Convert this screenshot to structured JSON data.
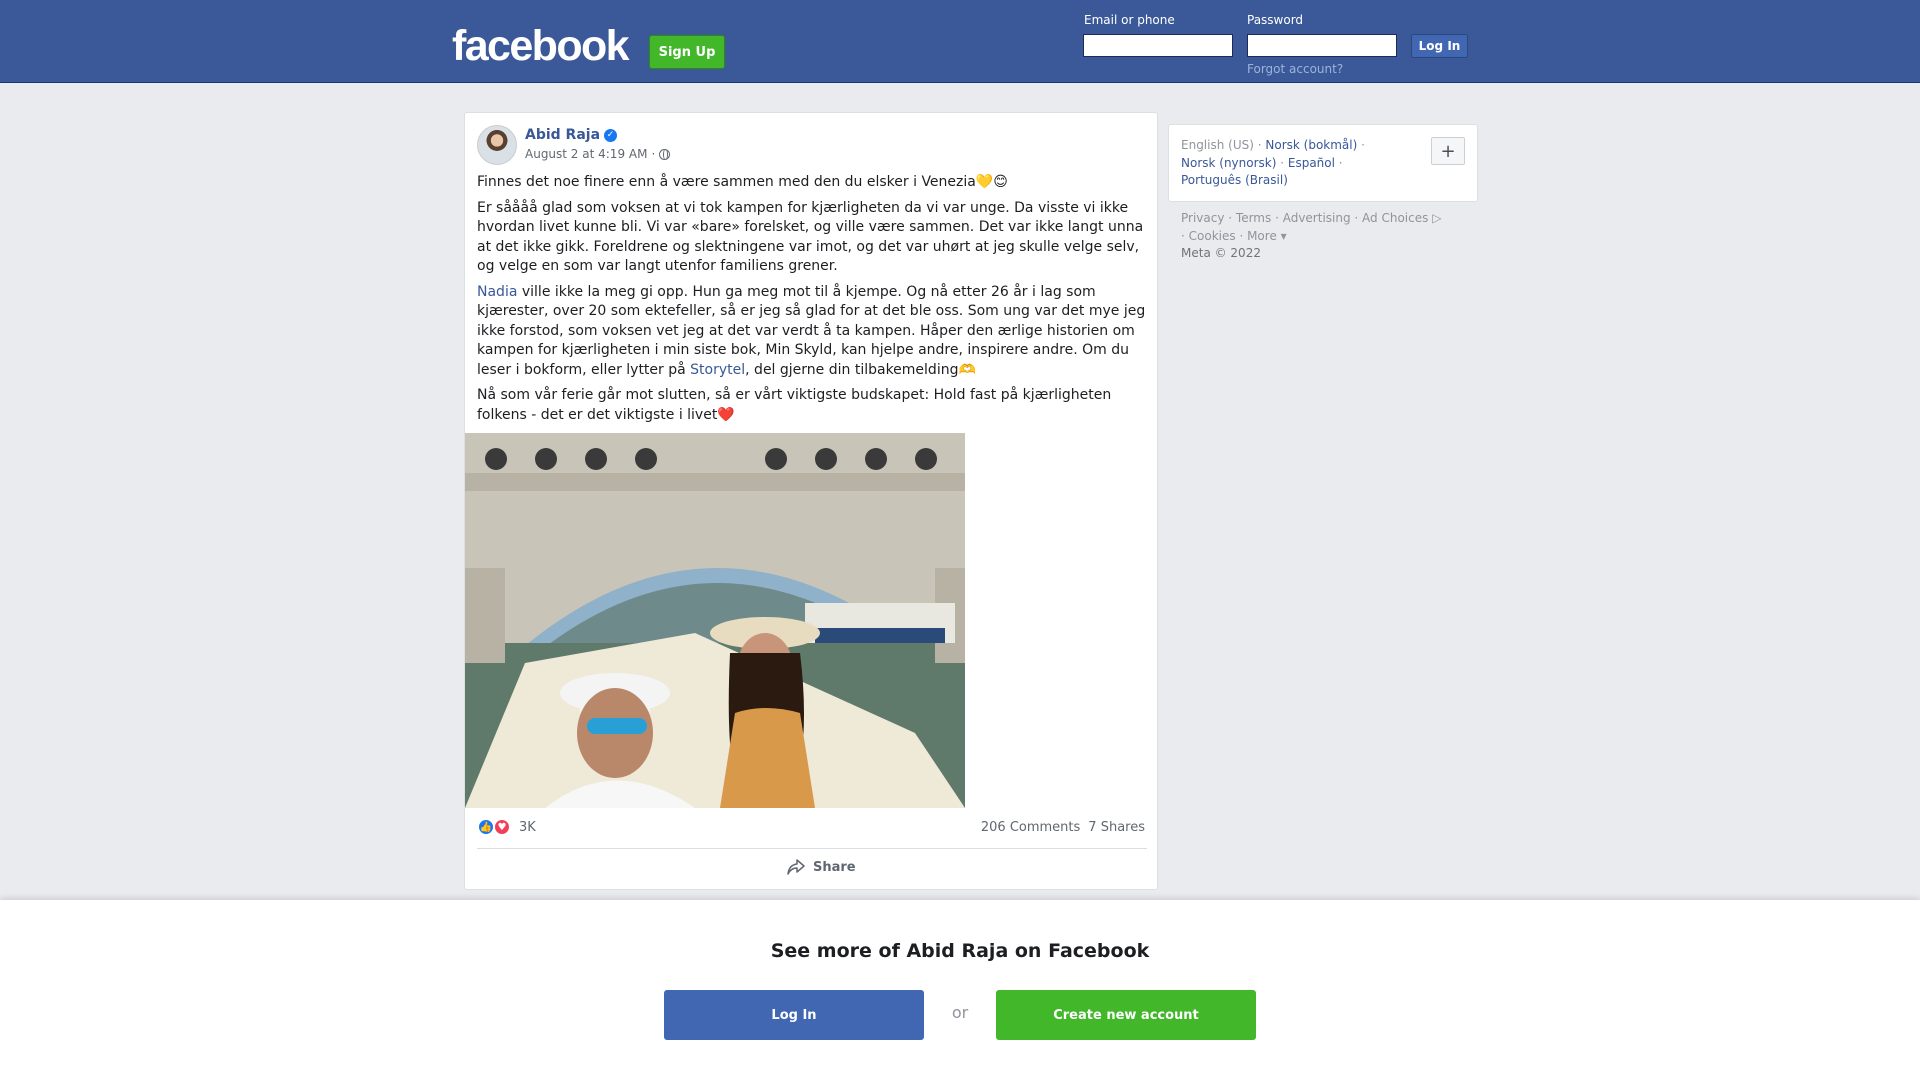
{
  "header": {
    "logo": "facebook",
    "signup_label": "Sign Up",
    "email_label": "Email or phone",
    "password_label": "Password",
    "login_label": "Log In",
    "forgot_label": "Forgot account?"
  },
  "post": {
    "author": "Abid Raja",
    "timestamp": "August 2 at 4:19 AM",
    "paragraphs": {
      "p1": "Finnes det noe finere enn å være sammen med den du elsker i Venezia💛😊",
      "p2": "Er såååå glad som voksen at vi tok kampen for kjærligheten da vi var unge. Da visste vi ikke hvordan livet kunne bli. Vi var «bare» forelsket, og ville være sammen. Det var ikke langt unna at det ikke gikk. Foreldrene og slektningene var imot, og det var uhørt at jeg skulle velge selv, og velge en som var langt utenfor familiens grener.",
      "p3_link": "Nadia",
      "p3_text": " ville ikke la meg gi opp. Hun ga meg mot til å kjempe. Og nå etter 26 år i lag som kjærester, over 20 som ektefeller, så er jeg så glad for at det ble oss. Som ung var det mye jeg ikke forstod, som voksen vet jeg at det var verdt å ta kampen. Håper den ærlige historien om kampen for kjærligheten i min siste bok, Min Skyld, kan hjelpe andre, inspirere andre. Om du leser i bokform, eller lytter på ",
      "p3_link2": "Storytel",
      "p3_end": ", del gjerne din tilbakemelding🫶",
      "p4": "Nå som vår ferie går mot slutten, så er vårt viktigste budskapet: Hold fast på kjærligheten folkens - det er det viktigste i livet❤️"
    },
    "reaction_count": "3K",
    "comments": "206 Comments",
    "shares": "7 Shares",
    "share_label": "Share"
  },
  "sidebar": {
    "lang_current": "English (US)",
    "lang_options": [
      "Norsk (bokmål)",
      "Norsk (nynorsk)",
      "Español",
      "Português (Brasil)"
    ],
    "footer": [
      "Privacy",
      "Terms",
      "Advertising",
      "Ad Choices",
      "Cookies",
      "More"
    ],
    "meta": "Meta © 2022"
  },
  "overlay": {
    "title": "See more of Abid Raja on Facebook",
    "login_label": "Log In",
    "or_label": "or",
    "create_label": "Create new account"
  },
  "colors": {
    "header_blue": "#3b5998",
    "link_blue": "#385898",
    "green": "#42b72a"
  }
}
